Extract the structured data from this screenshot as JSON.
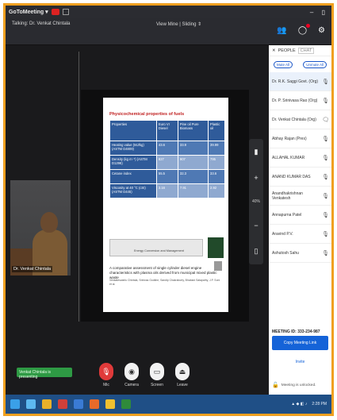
{
  "titlebar": {
    "app": "GoToMeeting ▾",
    "winctl": "– ▯"
  },
  "infobar": {
    "host": "Talking: Dr. Venkat Chintala",
    "view": "View Mine | Sliding ⇕"
  },
  "participant_tile": {
    "name": "Dr. Venkat Chintala"
  },
  "slide": {
    "title": "Physicochemical properties of fuels",
    "headers": [
      "Properties",
      "Euro VI Diesel",
      "Pine oil Pure Biomass",
      "Plastic oil"
    ],
    "rows": [
      [
        "Heating value (MJ/kg) (ASTM D4809)",
        "43.6",
        "33.9",
        "39.99"
      ],
      [
        "Density (kg m⁻³) (ASTM D1298)",
        "827",
        "907",
        "795"
      ],
      [
        "Cetane index",
        "55.5",
        "32.3",
        "33.6"
      ],
      [
        "Viscosity at 40 °C (cSt) (ASTM D445)",
        "3.16",
        "7.91",
        "2.92"
      ]
    ],
    "journal": "Energy Conversion and Management",
    "paper_title": "A comparative assessment of single cylinder diesel engine characteristics with plasma oils derived from municipal mixed plastic waste",
    "paper_authors": "Venkateswarlu Chintala, Srinivas Godkhe, Sandip Chakraborty, Bhabani Satapathy, J.P. Soni et al."
  },
  "share_tools": {
    "zoom": "40%"
  },
  "status_chip": "Venkat Chintala is presenting",
  "controls": [
    {
      "label": "Mic",
      "icon": "mic-icon"
    },
    {
      "label": "Camera",
      "icon": "camera-icon"
    },
    {
      "label": "Screen",
      "icon": "screen-icon"
    },
    {
      "label": "Leave",
      "icon": "leave-icon"
    }
  ],
  "panel": {
    "tab1": "PEOPLE",
    "tab2": "CHAT",
    "mute_all": "Mute All",
    "unmute_all": "Unmute All",
    "people": [
      {
        "name": "Dr. R.K. Saggi Govt. (Org)",
        "icon": "mic-icon"
      },
      {
        "name": "Dr. P. Srinivasa Rao (Org)",
        "icon": "mic-icon"
      },
      {
        "name": "Dr. Venkat Chintala (Org)",
        "icon": "chat-icon"
      },
      {
        "name": "Abhay Rajan (Pres)",
        "icon": "mic-icon"
      },
      {
        "name": "ALLAHAL KUMAR",
        "icon": "mic-icon"
      },
      {
        "name": "ANAND KUMAR DAS",
        "icon": "mic-icon"
      },
      {
        "name": "Anandhakrishnan Venkatesh",
        "icon": "mic-icon"
      },
      {
        "name": "Annapurna Patel",
        "icon": "mic-icon"
      },
      {
        "name": "Aravind P.V.",
        "icon": "mic-icon"
      },
      {
        "name": "Ashutosh Sahu",
        "icon": "mic-icon"
      }
    ],
    "meeting_id": "MEETING ID: 333-234-987",
    "copy_link": "Copy Meeting Link",
    "invite": "Invite",
    "unlocked": "Meeting is unlocked."
  },
  "taskbar": {
    "clock": "2:28 PM"
  }
}
